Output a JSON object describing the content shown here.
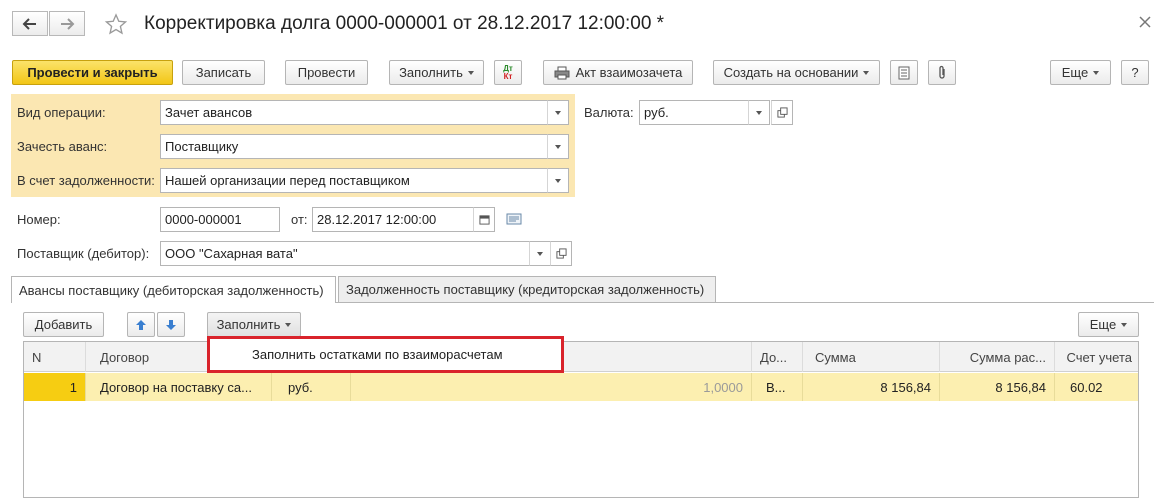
{
  "window": {
    "title": "Корректировка долга 0000-000001 от 28.12.2017 12:00:00 *",
    "icons": {
      "back": "arrow-left-icon",
      "forward": "arrow-right-icon",
      "favorite": "star-icon",
      "close": "close-icon"
    }
  },
  "toolbar": {
    "post_and_close": "Провести и закрыть",
    "save": "Записать",
    "post": "Провести",
    "fill": "Заполнить",
    "dt_kt_top": "Дт",
    "dt_kt_bottom": "Кт",
    "netting_act": "Акт взаимозачета",
    "create_based_on": "Создать на основании",
    "more": "Еще",
    "help": "?"
  },
  "form": {
    "operation_type": {
      "label": "Вид операции:",
      "value": "Зачет авансов"
    },
    "offset_advance": {
      "label": "Зачесть аванс:",
      "value": "Поставщику"
    },
    "debt_account": {
      "label": "В счет задолженности:",
      "value": "Нашей организации перед поставщиком"
    },
    "currency": {
      "label": "Валюта:",
      "value": "руб."
    },
    "number": {
      "label": "Номер:",
      "value": "0000-000001"
    },
    "date": {
      "label": "от:",
      "value": "28.12.2017 12:00:00"
    },
    "supplier": {
      "label": "Поставщик (дебитор):",
      "value": "ООО \"Сахарная вата\""
    }
  },
  "tabs": [
    {
      "label": "Авансы поставщику (дебиторская задолженность)",
      "active": true
    },
    {
      "label": "Задолженность поставщику (кредиторская задолженность)",
      "active": false
    }
  ],
  "tab_toolbar": {
    "add": "Добавить",
    "fill": "Заполнить",
    "more": "Еще"
  },
  "popup_menu": {
    "items": [
      "Заполнить остатками по взаиморасчетам"
    ],
    "highlight_color": "#d9232b"
  },
  "table": {
    "columns": [
      "N",
      "Договор",
      "До...",
      "Сумма",
      "Сумма рас...",
      "Счет учета"
    ],
    "rows": [
      {
        "n": "1",
        "contract": "Договор на поставку са...",
        "currency": "руб.",
        "rate": "1,0000",
        "doc": "В...",
        "amount": "8 156,84",
        "amount_settle": "8 156,84",
        "account": "60.02"
      }
    ]
  },
  "colors": {
    "primary_button": "#f2c616",
    "header_block": "#fbe7b2",
    "selected_row": "#fcefb0",
    "row_number_cell": "#f6cd12"
  }
}
